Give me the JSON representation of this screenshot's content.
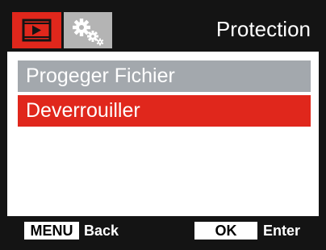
{
  "header": {
    "title": "Protection",
    "tabs": [
      {
        "icon": "playback-icon",
        "active": true
      },
      {
        "icon": "settings-gears-icon",
        "active": false
      }
    ]
  },
  "menu": {
    "items": [
      {
        "label": "Progeger Fichier",
        "state": "normal"
      },
      {
        "label": "Deverrouiller",
        "state": "selected"
      }
    ]
  },
  "footer": {
    "menu_key": "MENU",
    "menu_action": "Back",
    "ok_key": "OK",
    "ok_action": "Enter"
  },
  "colors": {
    "accent": "#e0271c",
    "item_normal": "#a3a8ad",
    "bar": "#141414",
    "tab_inactive": "#b4b4b4"
  }
}
